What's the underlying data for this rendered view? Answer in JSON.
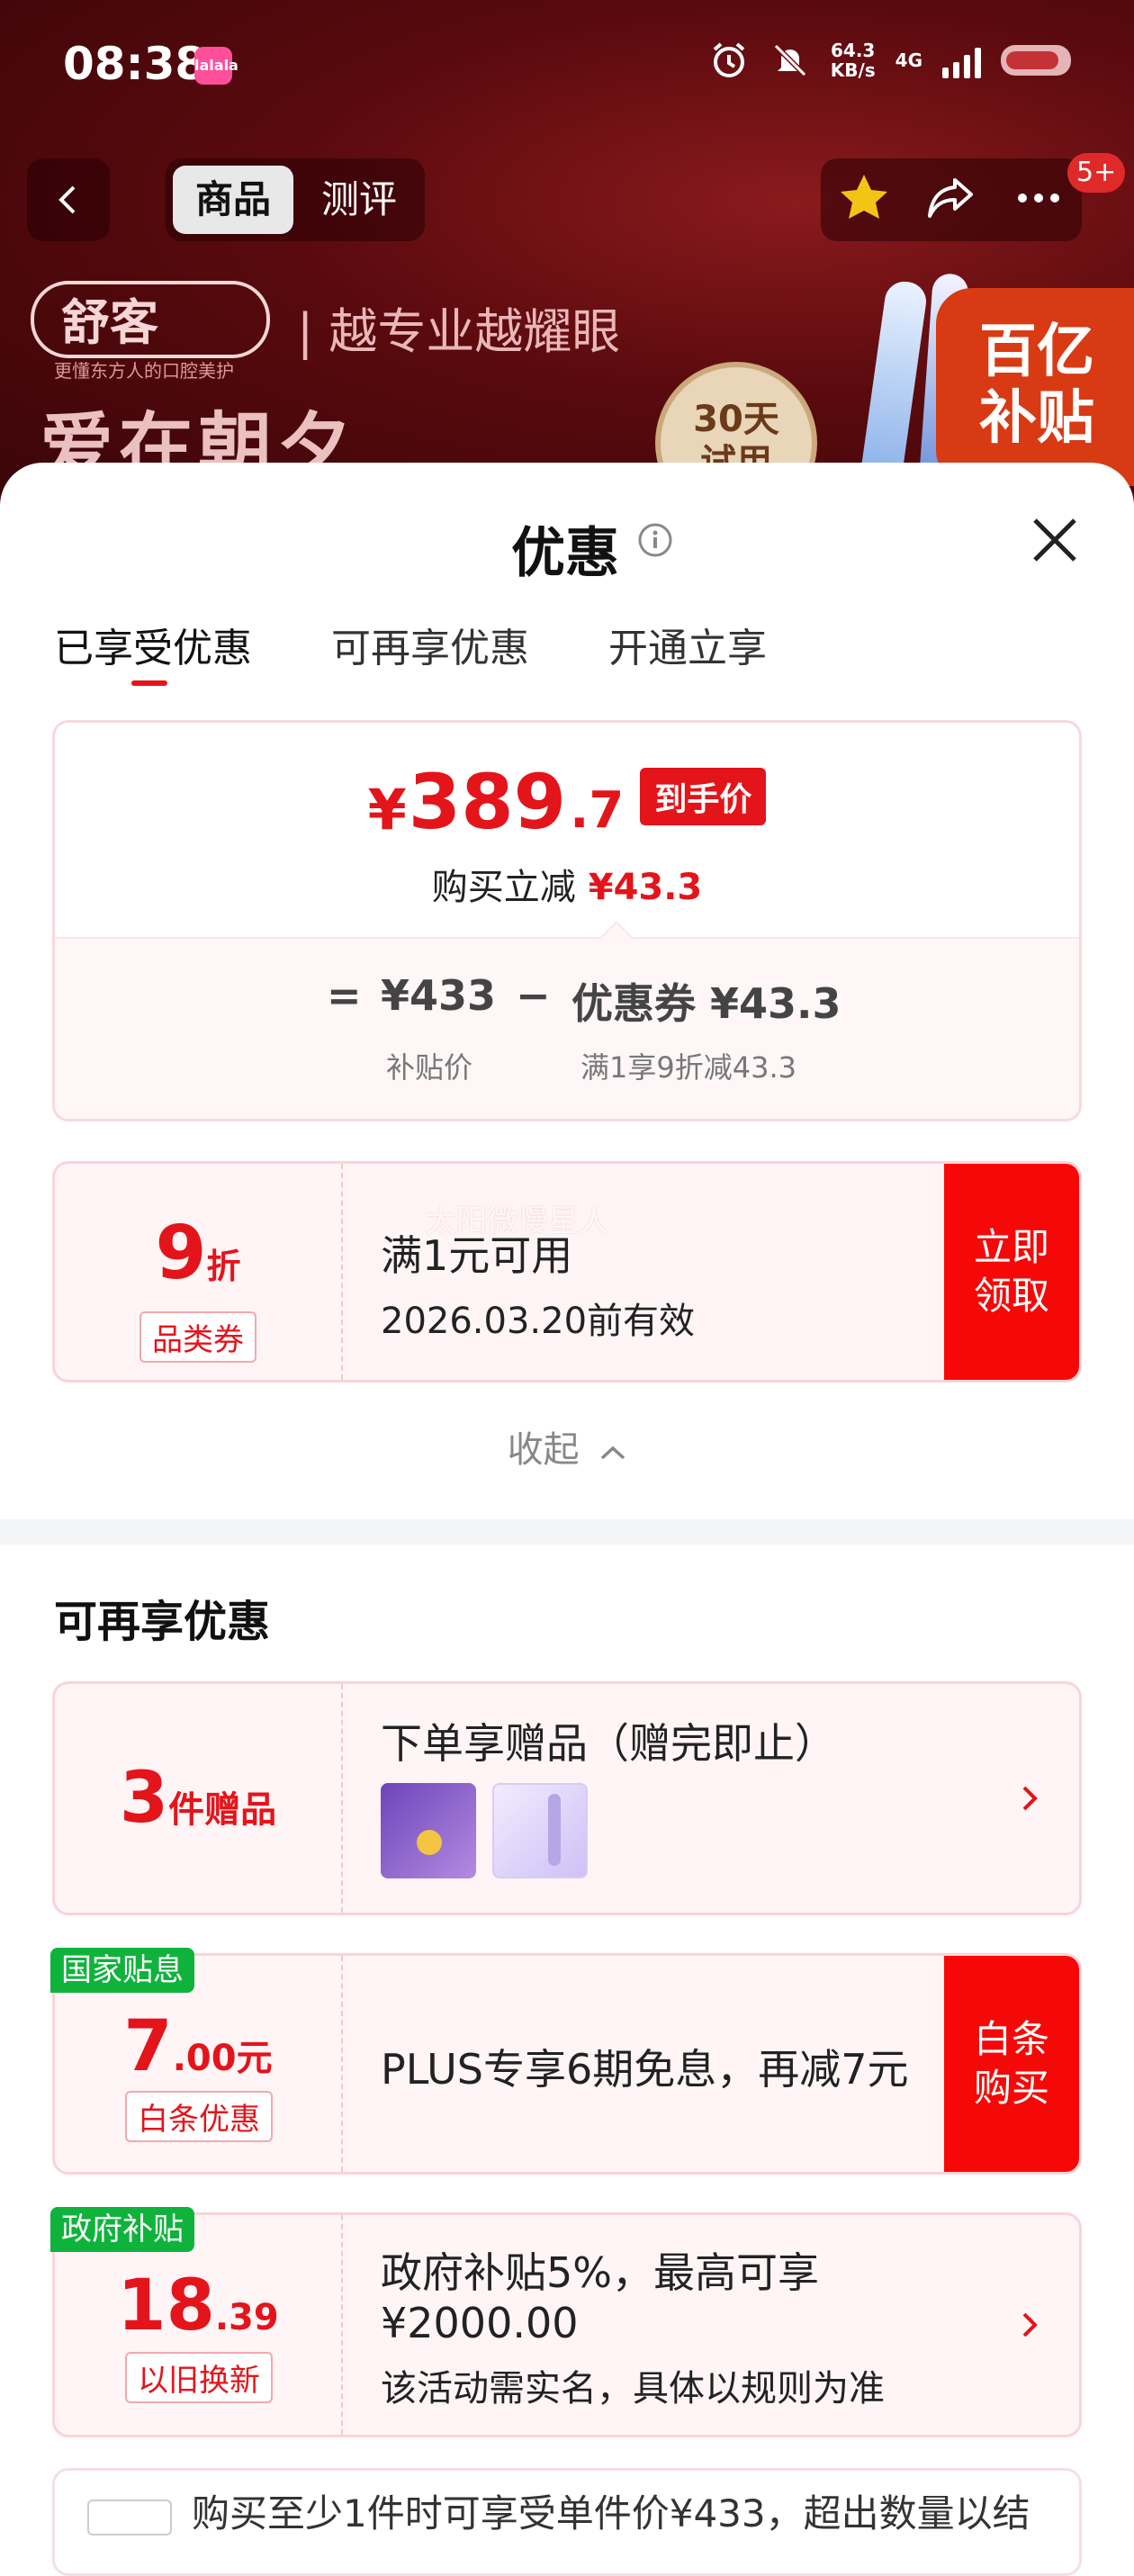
{
  "status_bar": {
    "time": "08:38",
    "speed_value": "64.3",
    "speed_unit": "KB/s",
    "network": "4G",
    "app_badge": "lalala"
  },
  "nav": {
    "tab_goods": "商品",
    "tab_reviews": "测评",
    "notification_count": "5+"
  },
  "banner": {
    "brand": "舒客",
    "brand_sub": "更懂东方人的口腔美护",
    "slogan": "越专业越耀眼",
    "big_text": "爱在朝夕",
    "trial_line1": "30天",
    "trial_line2": "试用",
    "subsidy_line1": "百亿",
    "subsidy_line2": "补贴"
  },
  "sheet": {
    "title": "优惠",
    "tabs": [
      {
        "label": "已享受优惠"
      },
      {
        "label": "可再享优惠"
      },
      {
        "label": "开通立享"
      }
    ]
  },
  "price": {
    "currency": "¥",
    "final_int": "389",
    "final_dec": ".7",
    "final_tag": "到手价",
    "reduce_label": "购买立减",
    "reduce_value": "¥43.3",
    "eq": "=",
    "subsidy_price": "¥433",
    "subsidy_label": "补贴价",
    "minus": "−",
    "coupon_label": "优惠券 ¥43.3",
    "coupon_note": "满1享9折减43.3"
  },
  "coupon": {
    "discount_num": "9",
    "discount_unit": "折",
    "type": "品类券",
    "condition": "满1元可用",
    "valid": "2026.03.20前有效",
    "action": "立即领取",
    "watermark": "太阳微慢星人"
  },
  "collapse": {
    "label": "收起"
  },
  "more": {
    "section_title": "可再享优惠",
    "gift": {
      "count": "3",
      "unit": "件赠品",
      "title": "下单享赠品（赠完即止）"
    },
    "plus": {
      "tag": "国家贴息",
      "amount_int": "7",
      "amount_dec": ".00元",
      "sub_tag": "白条优惠",
      "text": "PLUS专享6期免息，再减7元",
      "action": "白条购买"
    },
    "gov": {
      "tag": "政府补贴",
      "amount_int": "18",
      "amount_dec": ".39",
      "sub_tag": "以旧换新",
      "text": "政府补贴5%，最高可享¥2000.00",
      "note": "该活动需实名，具体以规则为准"
    },
    "bottom": {
      "text": "购买至少1件时可享受单件价¥433，超出数量以结"
    }
  },
  "colors": {
    "accent_red": "#e4141b",
    "action_red": "#f70808",
    "green_tag": "#0fb33c"
  }
}
